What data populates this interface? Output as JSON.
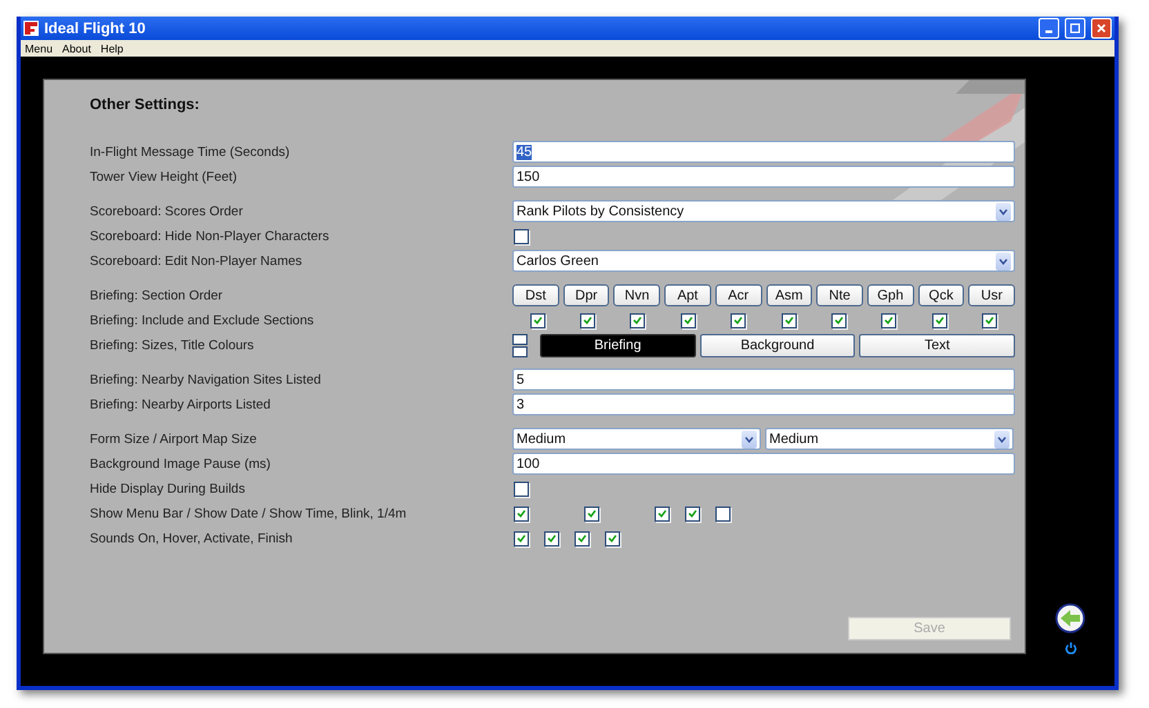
{
  "window": {
    "title": "Ideal Flight 10"
  },
  "menu": [
    "Menu",
    "About",
    "Help"
  ],
  "heading": "Other Settings:",
  "groups": [
    [
      {
        "label": "In-Flight Message Time (Seconds)",
        "kind": "text",
        "value": "45",
        "highlighted": true
      },
      {
        "label": "Tower View Height (Feet)",
        "kind": "text",
        "value": "150",
        "highlighted": false
      }
    ],
    [
      {
        "label": "Scoreboard: Scores Order",
        "kind": "select",
        "value": "Rank Pilots by Consistency"
      },
      {
        "label": "Scoreboard: Hide Non-Player Characters",
        "kind": "checks",
        "checks": [
          false
        ]
      },
      {
        "label": "Scoreboard: Edit Non-Player Names",
        "kind": "select",
        "value": "Carlos Green"
      }
    ],
    [
      {
        "label": "Briefing: Section Order",
        "kind": "buttons",
        "buttons": [
          "Dst",
          "Dpr",
          "Nvn",
          "Apt",
          "Acr",
          "Asm",
          "Nte",
          "Gph",
          "Qck",
          "Usr"
        ]
      },
      {
        "label": "Briefing: Include and Exclude Sections",
        "kind": "section-checks",
        "checks": [
          true,
          true,
          true,
          true,
          true,
          true,
          true,
          true,
          true,
          true
        ]
      },
      {
        "label": "Briefing: Sizes, Title Colours",
        "kind": "colours",
        "colours": [
          {
            "label": "Briefing",
            "selected": true
          },
          {
            "label": "Background",
            "selected": false
          },
          {
            "label": "Text",
            "selected": false
          }
        ]
      }
    ],
    [
      {
        "label": "Briefing: Nearby Navigation Sites Listed",
        "kind": "text",
        "value": "5",
        "highlighted": false
      },
      {
        "label": "Briefing: Nearby Airports Listed",
        "kind": "text",
        "value": "3",
        "highlighted": false
      }
    ],
    [
      {
        "label": "Form Size / Airport Map Size",
        "kind": "select-pair",
        "values": [
          "Medium",
          "Medium"
        ]
      },
      {
        "label": "Background Image Pause (ms)",
        "kind": "text",
        "value": "100",
        "highlighted": false
      },
      {
        "label": "Hide Display During Builds",
        "kind": "checks",
        "checks": [
          false
        ]
      },
      {
        "label": "Show Menu Bar / Show Date / Show Time, Blink, 1/4m",
        "kind": "spaced-checks",
        "checks": [
          true,
          true,
          true,
          true,
          false
        ]
      },
      {
        "label": "Sounds On, Hover, Activate, Finish",
        "kind": "checks",
        "checks": [
          true,
          true,
          true,
          true
        ]
      }
    ]
  ],
  "save": {
    "label": "Save",
    "disabled": true
  }
}
